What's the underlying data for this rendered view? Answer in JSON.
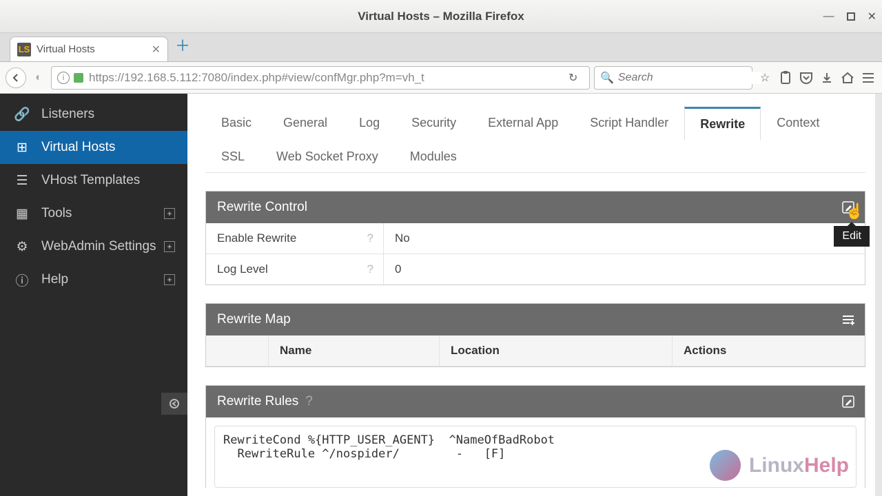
{
  "window": {
    "title": "Virtual Hosts – Mozilla Firefox"
  },
  "browser_tab": {
    "label": "Virtual Hosts",
    "favicon": "LS"
  },
  "urlbar": {
    "url": "https://192.168.5.112:7080/index.php#view/confMgr.php?m=vh_t"
  },
  "searchbar": {
    "placeholder": "Search"
  },
  "sidebar": {
    "items": [
      {
        "label": "Listeners"
      },
      {
        "label": "Virtual Hosts",
        "active": true
      },
      {
        "label": "VHost Templates"
      },
      {
        "label": "Tools",
        "expandable": true
      },
      {
        "label": "WebAdmin Settings",
        "expandable": true
      },
      {
        "label": "Help",
        "expandable": true
      }
    ]
  },
  "tabs": [
    "Basic",
    "General",
    "Log",
    "Security",
    "External App",
    "Script Handler",
    "Rewrite",
    "Context",
    "SSL",
    "Web Socket Proxy",
    "Modules"
  ],
  "active_tab": "Rewrite",
  "panels": {
    "rewrite_control": {
      "title": "Rewrite Control",
      "rows": [
        {
          "label": "Enable Rewrite",
          "value": "No"
        },
        {
          "label": "Log Level",
          "value": "0"
        }
      ]
    },
    "rewrite_map": {
      "title": "Rewrite Map",
      "columns": [
        "Name",
        "Location",
        "Actions"
      ]
    },
    "rewrite_rules": {
      "title": "Rewrite Rules",
      "content": "RewriteCond %{HTTP_USER_AGENT}  ^NameOfBadRobot\n  RewriteRule ^/nospider/        -   [F]"
    }
  },
  "tooltip": {
    "edit": "Edit"
  },
  "watermark": {
    "text_a": "Linux",
    "text_b": "Help"
  }
}
